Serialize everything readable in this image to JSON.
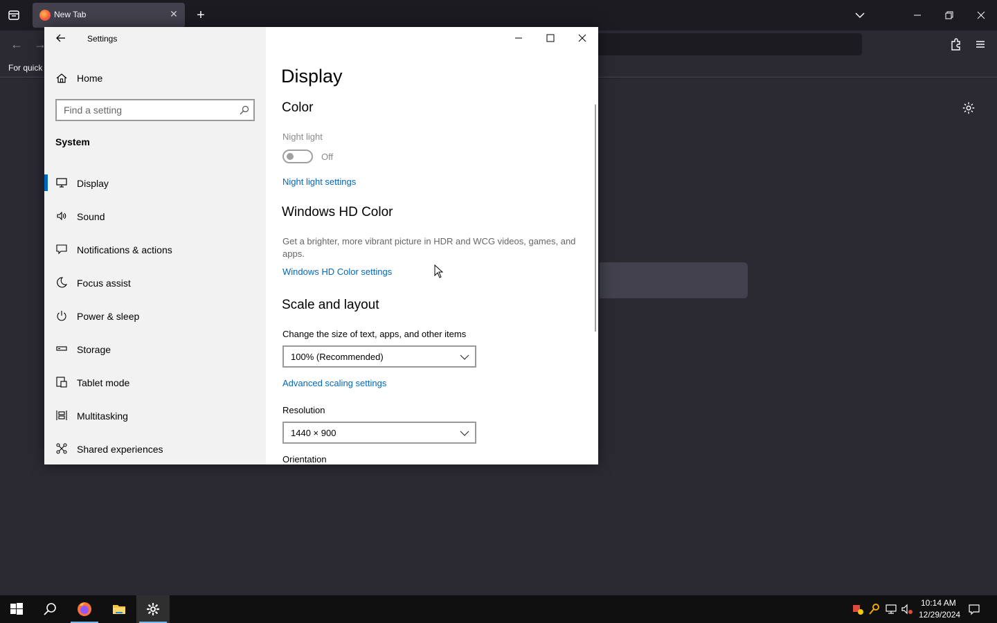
{
  "browser": {
    "tab_title": "New Tab",
    "bookmarks_text": "For quick"
  },
  "settings": {
    "app_title": "Settings",
    "nav": {
      "home_label": "Home",
      "search_placeholder": "Find a setting",
      "group_title": "System",
      "items": [
        {
          "label": "Display",
          "icon": "monitor-icon",
          "selected": true
        },
        {
          "label": "Sound",
          "icon": "speaker-icon"
        },
        {
          "label": "Notifications & actions",
          "icon": "message-icon"
        },
        {
          "label": "Focus assist",
          "icon": "moon-icon"
        },
        {
          "label": "Power & sleep",
          "icon": "power-icon"
        },
        {
          "label": "Storage",
          "icon": "storage-icon"
        },
        {
          "label": "Tablet mode",
          "icon": "tablet-icon"
        },
        {
          "label": "Multitasking",
          "icon": "multitasking-icon"
        },
        {
          "label": "Shared experiences",
          "icon": "shared-icon"
        }
      ]
    },
    "content": {
      "page_title": "Display",
      "color_header": "Color",
      "night_light_label": "Night light",
      "night_light_state": "Off",
      "night_light_link": "Night light settings",
      "hd_color_header": "Windows HD Color",
      "hd_color_desc": "Get a brighter, more vibrant picture in HDR and WCG videos, games, and apps.",
      "hd_color_link": "Windows HD Color settings",
      "scale_header": "Scale and layout",
      "scale_label": "Change the size of text, apps, and other items",
      "scale_value": "100% (Recommended)",
      "advanced_scaling_link": "Advanced scaling settings",
      "resolution_label": "Resolution",
      "resolution_value": "1440 × 900",
      "orientation_label": "Orientation"
    }
  },
  "taskbar": {
    "clock_time": "10:14 AM",
    "clock_date": "12/29/2024"
  },
  "colors": {
    "accent": "#0067c0",
    "taskbar": "#101010",
    "browser_bg": "#2b2a33"
  }
}
